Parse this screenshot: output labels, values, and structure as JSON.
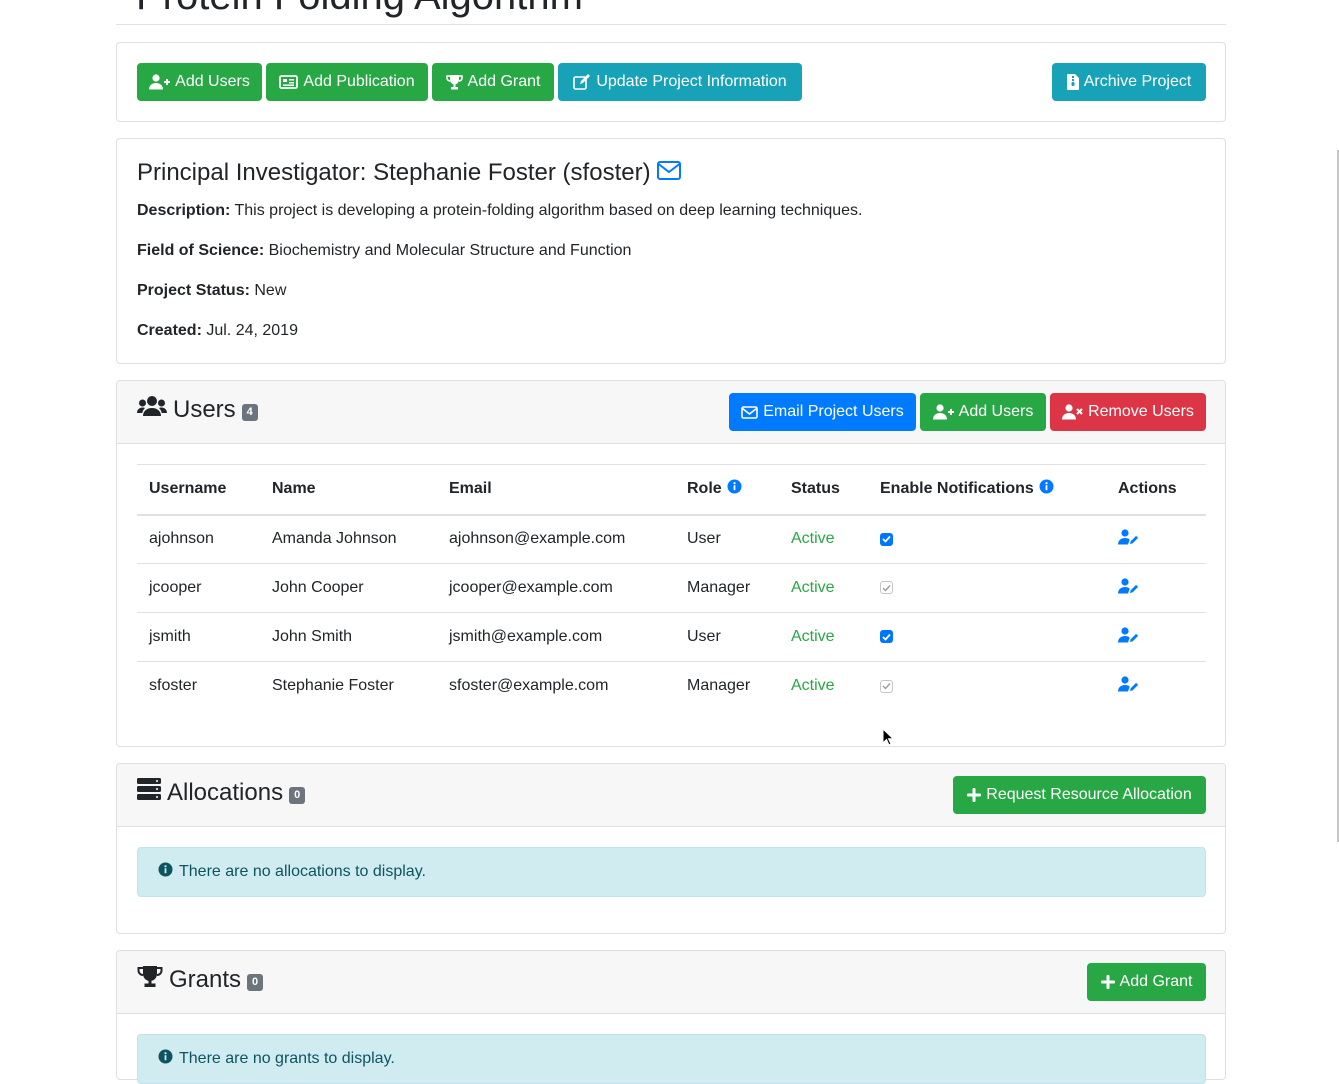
{
  "page": {
    "title": "Protein Folding Algorithm"
  },
  "toolbar": {
    "add_users": "Add Users",
    "add_publication": "Add Publication",
    "add_grant": "Add Grant",
    "update_project": "Update Project Information",
    "archive_project": "Archive Project"
  },
  "project": {
    "pi_heading": "Principal Investigator: Stephanie Foster (sfoster)",
    "description_label": "Description:",
    "description": " This project is developing a protein-folding algorithm based on deep learning techniques.",
    "field_label": "Field of Science:",
    "field": " Biochemistry and Molecular Structure and Function",
    "status_label": "Project Status:",
    "status": " New",
    "created_label": "Created:",
    "created": " Jul. 24, 2019"
  },
  "users": {
    "title": "Users",
    "count": "4",
    "email_button": "Email Project Users",
    "add_button": "Add Users",
    "remove_button": "Remove Users",
    "columns": [
      "Username",
      "Name",
      "Email",
      "Role",
      "Status",
      "Enable Notifications",
      "Actions"
    ],
    "rows": [
      {
        "username": "ajohnson",
        "name": "Amanda Johnson",
        "email": "ajohnson@example.com",
        "role": "User",
        "status": "Active",
        "notifications": true,
        "notifications_editable": true
      },
      {
        "username": "jcooper",
        "name": "John Cooper",
        "email": "jcooper@example.com",
        "role": "Manager",
        "status": "Active",
        "notifications": true,
        "notifications_editable": false
      },
      {
        "username": "jsmith",
        "name": "John Smith",
        "email": "jsmith@example.com",
        "role": "User",
        "status": "Active",
        "notifications": true,
        "notifications_editable": true
      },
      {
        "username": "sfoster",
        "name": "Stephanie Foster",
        "email": "sfoster@example.com",
        "role": "Manager",
        "status": "Active",
        "notifications": true,
        "notifications_editable": false
      }
    ]
  },
  "allocations": {
    "title": "Allocations",
    "count": "0",
    "request_button": "Request Resource Allocation",
    "empty_message": "There are no allocations to display."
  },
  "grants": {
    "title": "Grants",
    "count": "0",
    "add_button": "Add Grant",
    "empty_message": "There are no grants to display."
  },
  "colors": {
    "success": "#28a745",
    "info": "#17a2b8",
    "primary": "#007bff",
    "danger": "#dc3545",
    "alert_bg": "#d1ecf1",
    "badge": "#6c757d"
  }
}
